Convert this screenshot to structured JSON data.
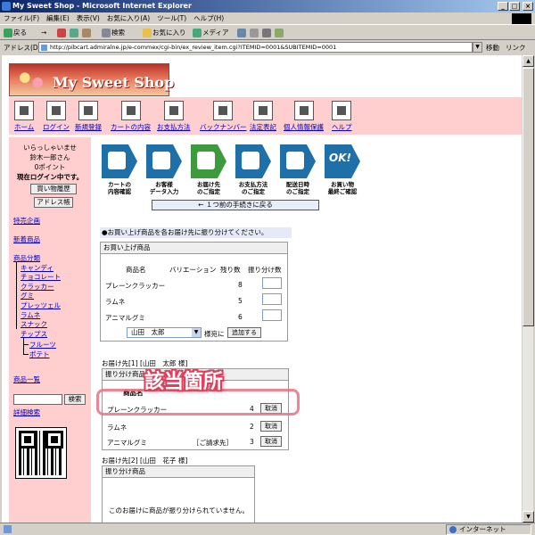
{
  "window": {
    "title": "My Sweet Shop - Microsoft Internet Explorer",
    "minimize": "_",
    "maximize": "□",
    "close": "×"
  },
  "menubar": [
    "ファイル(F)",
    "編集(E)",
    "表示(V)",
    "お気に入り(A)",
    "ツール(T)",
    "ヘルプ(H)"
  ],
  "toolbar": {
    "back": "戻る",
    "forward": "→",
    "search": "検索",
    "favorites": "お気に入り",
    "media": "メディア"
  },
  "address": {
    "label": "アドレス(D)",
    "url": "http://pibcart.admiralne.jp/e-commex/cgi-bin/ex_review_item.cgi?ITEMID=0001&SUBITEMID=0001",
    "go": "移動",
    "links": "リンク"
  },
  "status": {
    "zone": "インターネット"
  },
  "shop": {
    "logo_text": "My Sweet Shop",
    "nav": [
      "ホーム",
      "ログイン",
      "新規登録",
      "カートの内容",
      "お支払方法",
      "バックナンバー",
      "法定表記",
      "個人情報保護",
      "ヘルプ"
    ]
  },
  "sidebar": {
    "welcome": "いらっしゃいませ",
    "user": "鈴木一郎さん",
    "points": "0ポイント",
    "login_status": "現在ログイン中です。",
    "history_button": "買い物履歴",
    "address_button": "アドレス帳",
    "special": "特売企画",
    "new_items": "新着商品",
    "categories_title": "商品分類",
    "categories": [
      "キャンディ",
      "チョコレート",
      "クラッカー",
      "グミ",
      "プレッツェル",
      "ラムネ",
      "スナック",
      "チップス"
    ],
    "subcategories": [
      "フルーツ",
      "ポテト"
    ],
    "product_list": "商品一覧",
    "search_button": "検索",
    "detailed_search": "詳細検索"
  },
  "steps": [
    {
      "line1": "カートの",
      "line2": "内容確認"
    },
    {
      "line1": "お客様",
      "line2": "データ入力"
    },
    {
      "line1": "お届け先",
      "line2": "のご指定"
    },
    {
      "line1": "お支払方法",
      "line2": "のご指定"
    },
    {
      "line1": "配送日時",
      "line2": "のご指定"
    },
    {
      "line1": "お買い物",
      "line2": "最終ご確認",
      "icon": "OK!"
    }
  ],
  "back_button": "← １つ前の手続きに戻る",
  "instruction": "●お買い上げ商品を各お届け先に振り分けてください。",
  "purchase": {
    "title": "お買い上げ商品",
    "headers": [
      "商品名",
      "バリエーション",
      "残り数",
      "振り分け数"
    ],
    "rows": [
      {
        "name": "プレーンクラッカー",
        "remaining": "8"
      },
      {
        "name": "ラムネ",
        "remaining": "5"
      },
      {
        "name": "アニマルグミ",
        "remaining": "6"
      }
    ],
    "recipient_select": "山田　太郎",
    "suffix": "様宛に",
    "add_button": "追加する"
  },
  "delivery1": {
    "title": "お届け先[1] [山田　太郎 様]",
    "subtitle": "振り分け商品",
    "header_partial": "商品名",
    "rows": [
      {
        "name": "プレーンクラッカー",
        "variation": "",
        "qty": "4",
        "cancel": "取消"
      },
      {
        "name": "ラムネ",
        "variation": "",
        "qty": "2",
        "cancel": "取消"
      },
      {
        "name": "アニマルグミ",
        "variation": "［ご請求先］",
        "qty": "3",
        "cancel": "取消"
      }
    ]
  },
  "delivery2": {
    "title": "お届け先[2] [山田　花子 様]",
    "subtitle": "振り分け商品",
    "empty_message": "このお届けに商品が振り分けられていません。"
  },
  "callout": "該当箇所",
  "colors": {
    "sidebar_bg": "#ffcece",
    "step_blue": "#1f6fa8",
    "step_current": "#3d9a3d",
    "highlight": "#eb6e82",
    "link": "#0000cc"
  }
}
